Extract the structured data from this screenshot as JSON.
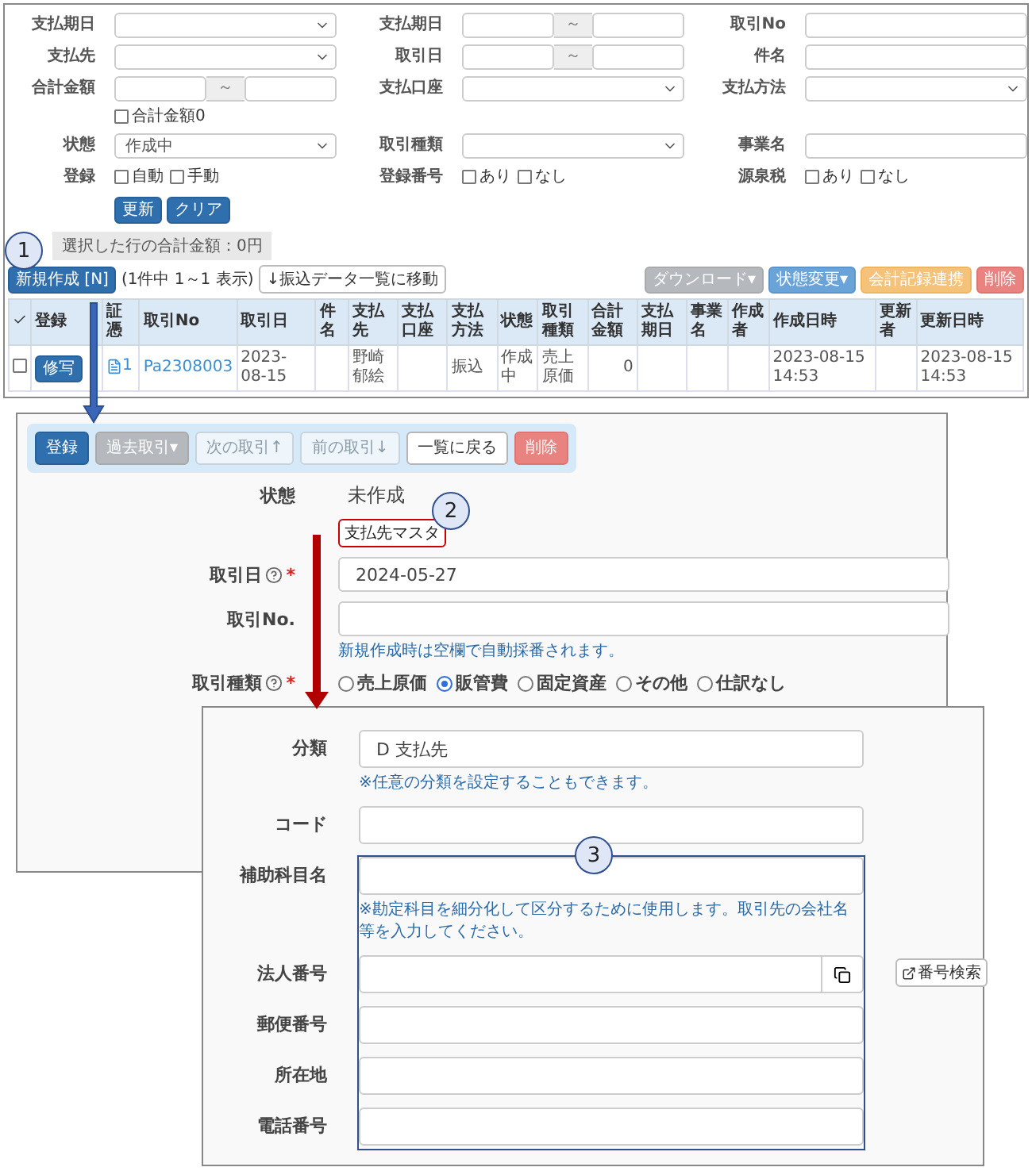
{
  "search_form": {
    "rows": [
      [
        {
          "label": "支払期日",
          "kind": "select"
        },
        {
          "label": "支払期日",
          "kind": "range",
          "separator": "～"
        },
        {
          "label": "取引No",
          "kind": "text"
        }
      ],
      [
        {
          "label": "支払先",
          "kind": "select"
        },
        {
          "label": "取引日",
          "kind": "range",
          "separator": "～"
        },
        {
          "label": "件名",
          "kind": "text"
        }
      ],
      [
        {
          "label": "合計金額",
          "kind": "range",
          "separator": "～",
          "checkbox": {
            "label": "合計金額0",
            "checked": false
          }
        },
        {
          "label": "支払口座",
          "kind": "select"
        },
        {
          "label": "支払方法",
          "kind": "select"
        }
      ],
      [
        {
          "label": "状態",
          "kind": "select",
          "value": "作成中"
        },
        {
          "label": "取引種類",
          "kind": "select"
        },
        {
          "label": "事業名",
          "kind": "text"
        }
      ],
      [
        {
          "label": "登録",
          "kind": "checks",
          "options": [
            {
              "label": "自動",
              "checked": false
            },
            {
              "label": "手動",
              "checked": false
            }
          ]
        },
        {
          "label": "登録番号",
          "kind": "checks",
          "options": [
            {
              "label": "あり",
              "checked": false
            },
            {
              "label": "なし",
              "checked": false
            }
          ]
        },
        {
          "label": "源泉税",
          "kind": "checks",
          "options": [
            {
              "label": "あり",
              "checked": false
            },
            {
              "label": "なし",
              "checked": false
            }
          ]
        }
      ]
    ],
    "buttons": [
      {
        "label": "更新",
        "kind": "primary"
      },
      {
        "label": "クリア",
        "kind": "primary"
      }
    ]
  },
  "summary": "選択した行の合計金額：0円",
  "list_toolbar": {
    "new_button": {
      "label": "新規作成 [N]",
      "kind": "primary"
    },
    "count": "(1件中 1～1 表示)",
    "link_button": "↓振込データ一覧に移動",
    "right_buttons": [
      {
        "label": "ダウンロード▾",
        "kind": "gray"
      },
      {
        "label": "状態変更▾",
        "kind": "info"
      },
      {
        "label": "会計記録連携",
        "kind": "warning"
      },
      {
        "label": "削除",
        "kind": "danger"
      }
    ]
  },
  "table": {
    "columns": [
      {
        "kind": "select_all"
      },
      {
        "label": "登録"
      },
      {
        "label": "証憑"
      },
      {
        "label": "取引No"
      },
      {
        "label": "取引日"
      },
      {
        "label": "件名"
      },
      {
        "label": "支払先"
      },
      {
        "label": "支払口座"
      },
      {
        "label": "支払方法"
      },
      {
        "label": "状態"
      },
      {
        "label": "取引種類"
      },
      {
        "label": "合計金額"
      },
      {
        "label": "支払期日"
      },
      {
        "label": "事業名"
      },
      {
        "label": "作成者"
      },
      {
        "label": "作成日時"
      },
      {
        "label": "更新者"
      },
      {
        "label": "更新日時"
      }
    ],
    "rows": [
      {
        "cells": [
          {
            "kind": "checkbox",
            "checked": false
          },
          {
            "kind": "button",
            "text": "修写"
          },
          {
            "kind": "attachment",
            "text": "1"
          },
          {
            "kind": "link",
            "text": "Pa2308003"
          },
          {
            "kind": "text",
            "text": "2023-08-15"
          },
          {
            "kind": "empty"
          },
          {
            "kind": "text",
            "text": "野崎郁絵"
          },
          {
            "kind": "empty"
          },
          {
            "kind": "text",
            "text": "振込"
          },
          {
            "kind": "text",
            "text": "作成中"
          },
          {
            "kind": "text",
            "text": "売上原価"
          },
          {
            "kind": "number",
            "text": "0"
          },
          {
            "kind": "empty"
          },
          {
            "kind": "empty"
          },
          {
            "kind": "empty"
          },
          {
            "kind": "text",
            "text": "2023-08-15 14:53"
          },
          {
            "kind": "empty"
          },
          {
            "kind": "text",
            "text": "2023-08-15 14:53"
          }
        ]
      }
    ]
  },
  "detail": {
    "toolbar": [
      {
        "label": "登録",
        "kind": "primary"
      },
      {
        "label": "過去取引▾",
        "kind": "gray"
      },
      {
        "label": "次の取引↑",
        "kind": "disabled"
      },
      {
        "label": "前の取引↓",
        "kind": "disabled"
      },
      {
        "label": "一覧に戻る",
        "kind": "default"
      },
      {
        "label": "削除",
        "kind": "danger"
      }
    ],
    "status": {
      "label": "状態",
      "value": "未作成"
    },
    "master_label": "支払先マスタ",
    "date": {
      "label": "取引日",
      "help": true,
      "mark": "*",
      "value": "2024-05-27"
    },
    "number": {
      "label": "取引No.",
      "help_text": "新規作成時は空欄で自動採番されます。"
    },
    "type": {
      "label": "取引種類",
      "help": true,
      "mark": "*",
      "options": [
        {
          "label": "売上原価",
          "selected": false
        },
        {
          "label": "販管費",
          "selected": true
        },
        {
          "label": "固定資産",
          "selected": false
        },
        {
          "label": "その他",
          "selected": false
        },
        {
          "label": "仕訳なし",
          "selected": false
        }
      ]
    }
  },
  "master_form": {
    "fields": [
      {
        "label": "分類",
        "kind": "text",
        "value": "D 支払先",
        "help_text": "※任意の分類を設定することもできます。"
      },
      {
        "label": "コード",
        "kind": "text"
      },
      {
        "label": "補助科目名",
        "kind": "text",
        "help_text": "※勘定科目を細分化して区分するために使用します。取引先の会社名等を入力してください。"
      },
      {
        "label": "法人番号",
        "kind": "lookup",
        "side_button": "番号検索"
      },
      {
        "label": "郵便番号",
        "kind": "text"
      },
      {
        "label": "所在地",
        "kind": "text"
      },
      {
        "label": "電話番号",
        "kind": "text"
      }
    ]
  },
  "callouts": [
    "1",
    "2",
    "3"
  ]
}
